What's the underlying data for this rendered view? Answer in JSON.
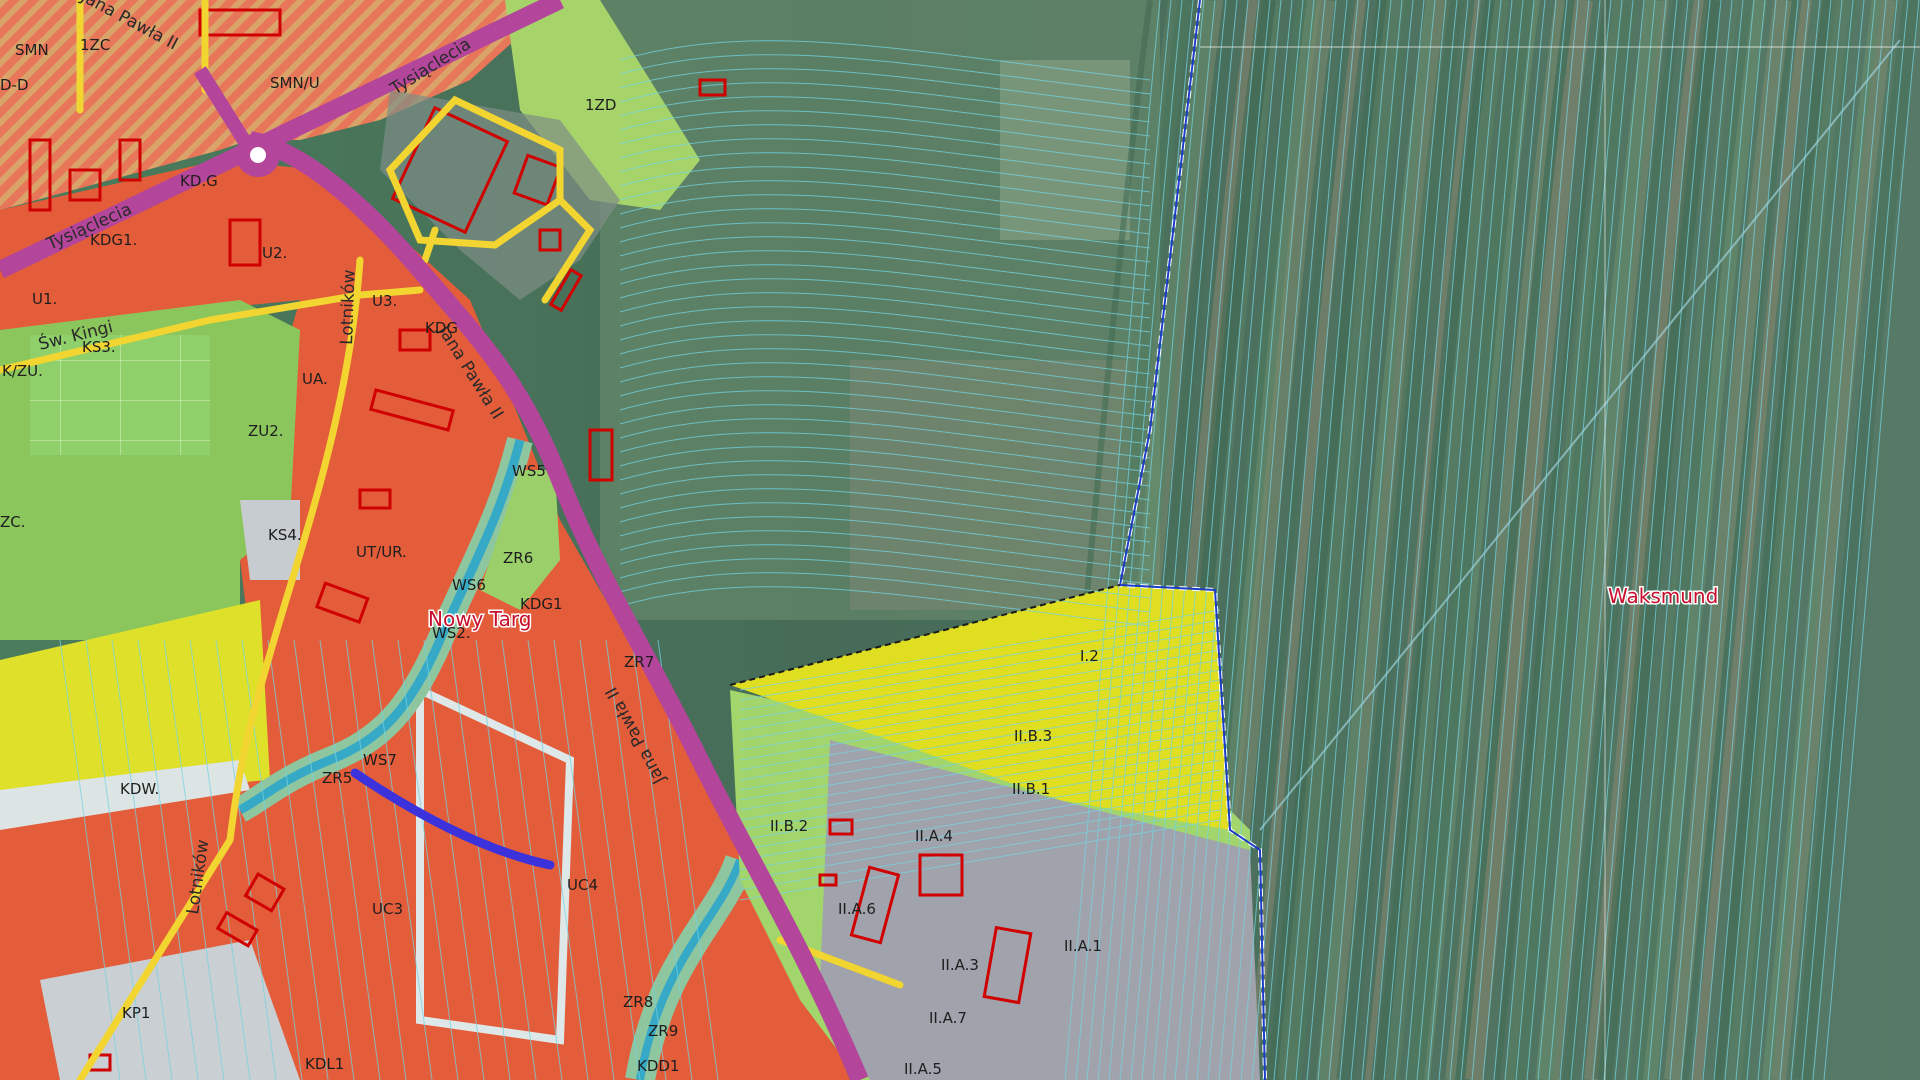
{
  "map": {
    "places": [
      "Nowy Targ",
      "Waksmund"
    ],
    "streets": {
      "jana_pawla_top": "Jana Pawła II",
      "jana_pawla_mid": "Jana Pawła II",
      "jana_pawla_bottom": "Jana Pawła II",
      "tysiaclecia_top": "Tysiąclecia",
      "tysiaclecia_left": "Tysiąclecia",
      "lotnikow_top": "Lotników",
      "lotnikow_bottom": "Lotników",
      "sw_kingi": "Św. Kingi"
    },
    "zones": [
      "1ZC",
      "SMN",
      "D-D",
      "SMN/U",
      "1ZD",
      "KDG1.",
      "U2.",
      "U1.",
      "U3.",
      "KDG",
      "KS3.",
      "K/ZU.",
      "UA.",
      "ZU2.",
      "ZC.",
      "KS4.",
      "WS5",
      "UT/UR.",
      "ZR6",
      "WS6",
      "KDG1",
      "WS2.",
      "ZR7",
      "WS7",
      "ZR5",
      "KDW.",
      "UC4",
      "UC3",
      "KP1",
      "ZR8",
      "ZR9",
      "KDD1",
      "KDL1",
      "I.2",
      "II.B.3",
      "II.B.1",
      "II.B.2",
      "II.A.4",
      "II.A.6",
      "II.A.1",
      "II.A.3",
      "II.A.7",
      "II.A.5",
      "KD.G"
    ],
    "colors": {
      "residential_hatched": "#e8775a",
      "services": "#e35f3c",
      "green_light": "#9dcd62",
      "green_park": "#8cc75e",
      "yellow_agri": "#dedc1c",
      "grey_industrial": "#9ea0a8",
      "road_main": "#b3459a",
      "road_yellow": "#f2d531",
      "water": "#36a9c6",
      "building_outline": "#d00000",
      "parcel_line": "#74d3e3",
      "admin_boundary": "#1c3ec7",
      "stream_blue": "#3c32dc"
    }
  }
}
